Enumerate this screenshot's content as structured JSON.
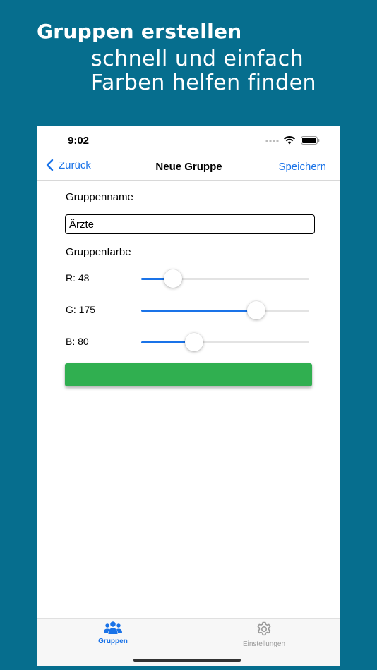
{
  "promo": {
    "headline": "Gruppen erstellen",
    "line1": "schnell und einfach",
    "line2": "Farben helfen finden"
  },
  "status_bar": {
    "time": "9:02"
  },
  "nav": {
    "back_label": "Zurück",
    "title": "Neue Gruppe",
    "save_label": "Speichern"
  },
  "form": {
    "name_label": "Gruppenname",
    "name_value": "Ärzte",
    "color_label": "Gruppenfarbe",
    "sliders": [
      {
        "label": "R: 48",
        "value": 48,
        "max": 255
      },
      {
        "label": "G: 175",
        "value": 175,
        "max": 255
      },
      {
        "label": "B: 80",
        "value": 80,
        "max": 255
      }
    ],
    "preview_color": "#30AF50"
  },
  "tabs": [
    {
      "label": "Gruppen",
      "icon": "people-icon",
      "active": true
    },
    {
      "label": "Einstellungen",
      "icon": "gear-icon",
      "active": false
    }
  ],
  "colors": {
    "background": "#066E8E",
    "accent": "#1A73E8"
  }
}
